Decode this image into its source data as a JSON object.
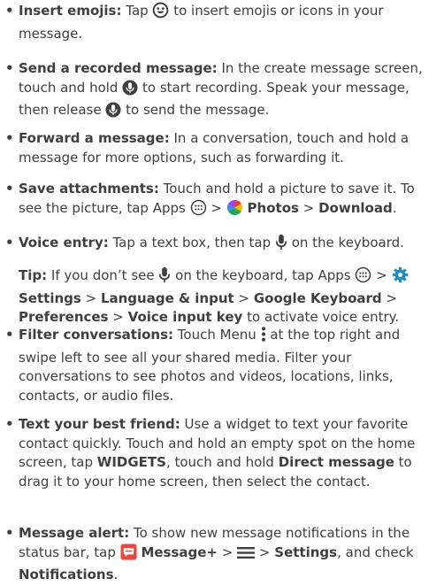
{
  "bullet_char": "•",
  "items": [
    {
      "label": "Insert emojis:",
      "t1": "Tap",
      "t2": "to insert emojis or icons in your message."
    },
    {
      "label": "Send a recorded message:",
      "t1": "In the create message screen, touch and hold",
      "t2": "to start recording. Speak your message, then release",
      "t3": "to send the message."
    },
    {
      "label": "Forward a message:",
      "t1": "In a conversation, touch and hold a message for more options, such as forwarding it."
    },
    {
      "label": "Save attachments:",
      "t1": "Touch and hold a picture to save it. To see the picture, tap Apps",
      "sep1": ">",
      "photos": "Photos",
      "sep2": ">",
      "download": "Download",
      "end": "."
    },
    {
      "label": "Voice entry:",
      "t1": "Tap a text box, then tap",
      "t2": "on the keyboard."
    },
    {
      "label": "Filter conversations:",
      "t1": "Touch Menu",
      "t2": "at the top right and swipe left to see all your shared media. Filter your conversations to see photos and videos, locations, links, contacts, or audio files."
    },
    {
      "label": "Text your best friend:",
      "t1": "Use a widget to text your favorite contact quickly. Touch and hold an empty spot on the home screen, tap",
      "widgets": "WIDGETS",
      "t2": ", touch and hold",
      "direct": "Direct message",
      "t3": "to drag it to your home screen, then select the contact."
    },
    {
      "label": "Message alert:",
      "t1": "To show new message notifications in the status bar, tap",
      "app": "Message+",
      "sep1": ">",
      "sep2": ">",
      "settings": "Settings",
      "t2": ", and check",
      "notif": "Notifications",
      "end": "."
    }
  ],
  "tip": {
    "label": "Tip:",
    "t1": "If you don’t see",
    "t2": "on the keyboard, tap Apps",
    "sep1": ">",
    "settings": "Settings",
    "sep2": ">",
    "lang": "Language & input",
    "sep3": ">",
    "gk": "Google Keyboard",
    "sep4": ">",
    "pref": "Preferences",
    "sep5": ">",
    "vik": "Voice input key",
    "t3": "to activate voice entry."
  },
  "colors": {
    "text": "#3f3f3f",
    "settings_icon": "#1e8fc6",
    "message_icon": "#e8473f"
  }
}
